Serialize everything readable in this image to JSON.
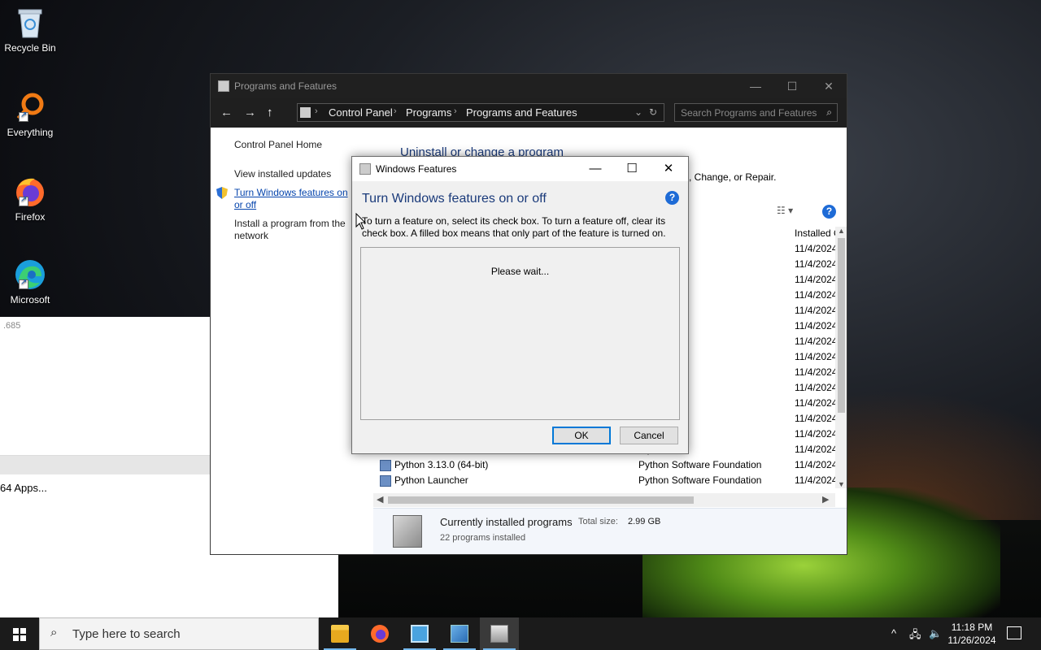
{
  "desktop": {
    "icons": [
      {
        "label": "Recycle Bin",
        "icon": "recycle-bin-icon"
      },
      {
        "label": "Everything",
        "icon": "everything-search-icon"
      },
      {
        "label": "Firefox",
        "icon": "firefox-icon"
      },
      {
        "label": "Microsoft",
        "icon": "edge-icon"
      }
    ]
  },
  "bg_app": {
    "version_fragment": ".685",
    "apps_text": "64 Apps..."
  },
  "programs_window": {
    "title": "Programs and Features",
    "breadcrumb": [
      "Control Panel",
      "Programs",
      "Programs and Features"
    ],
    "search_placeholder": "Search Programs and Features",
    "left_links": {
      "home": "Control Panel Home",
      "updates": "View installed updates",
      "features": "Turn Windows features on or off",
      "network": "Install a program from the network"
    },
    "heading": "Uninstall or change a program",
    "subheading": ", Change, or Repair.",
    "column_installed": "Installed O",
    "rows": [
      {
        "name": "",
        "publisher": "",
        "date": "11/4/2024"
      },
      {
        "name": "",
        "publisher": "ptium",
        "date": "11/4/2024"
      },
      {
        "name": "",
        "publisher": "",
        "date": "11/4/2024"
      },
      {
        "name": "",
        "publisher": "orporation",
        "date": "11/4/2024"
      },
      {
        "name": "",
        "publisher": "orporation",
        "date": "11/4/2024"
      },
      {
        "name": "",
        "publisher": "orporation",
        "date": "11/4/2024"
      },
      {
        "name": "",
        "publisher": "orporation",
        "date": "11/4/2024"
      },
      {
        "name": "",
        "publisher": "orporation",
        "date": "11/4/2024"
      },
      {
        "name": "",
        "publisher": "orporation",
        "date": "11/4/2024"
      },
      {
        "name": "",
        "publisher": "orporation",
        "date": "11/4/2024"
      },
      {
        "name": "",
        "publisher": "",
        "date": "11/4/2024"
      },
      {
        "name": "",
        "publisher": "",
        "date": "11/4/2024"
      },
      {
        "name": "",
        "publisher": "Team",
        "date": "11/4/2024"
      },
      {
        "name": "",
        "publisher": "orporation",
        "date": "11/4/2024"
      },
      {
        "name": "Python 3.13.0 (64-bit)",
        "publisher": "Python Software Foundation",
        "date": "11/4/2024"
      },
      {
        "name": "Python Launcher",
        "publisher": "Python Software Foundation",
        "date": "11/4/2024"
      }
    ],
    "status": {
      "title": "Currently installed programs",
      "total_label": "Total size:",
      "total_value": "2.99 GB",
      "count": "22 programs installed"
    }
  },
  "features_dialog": {
    "title": "Windows Features",
    "heading": "Turn Windows features on or off",
    "description": "To turn a feature on, select its check box. To turn a feature off, clear its check box. A filled box means that only part of the feature is turned on.",
    "wait_text": "Please wait...",
    "ok_label": "OK",
    "cancel_label": "Cancel"
  },
  "taskbar": {
    "search_placeholder": "Type here to search",
    "time": "11:18 PM",
    "date": "11/26/2024"
  },
  "colors": {
    "accent": "#0078d7",
    "heading_blue": "#1a3a7a",
    "link": "#0645ad"
  }
}
